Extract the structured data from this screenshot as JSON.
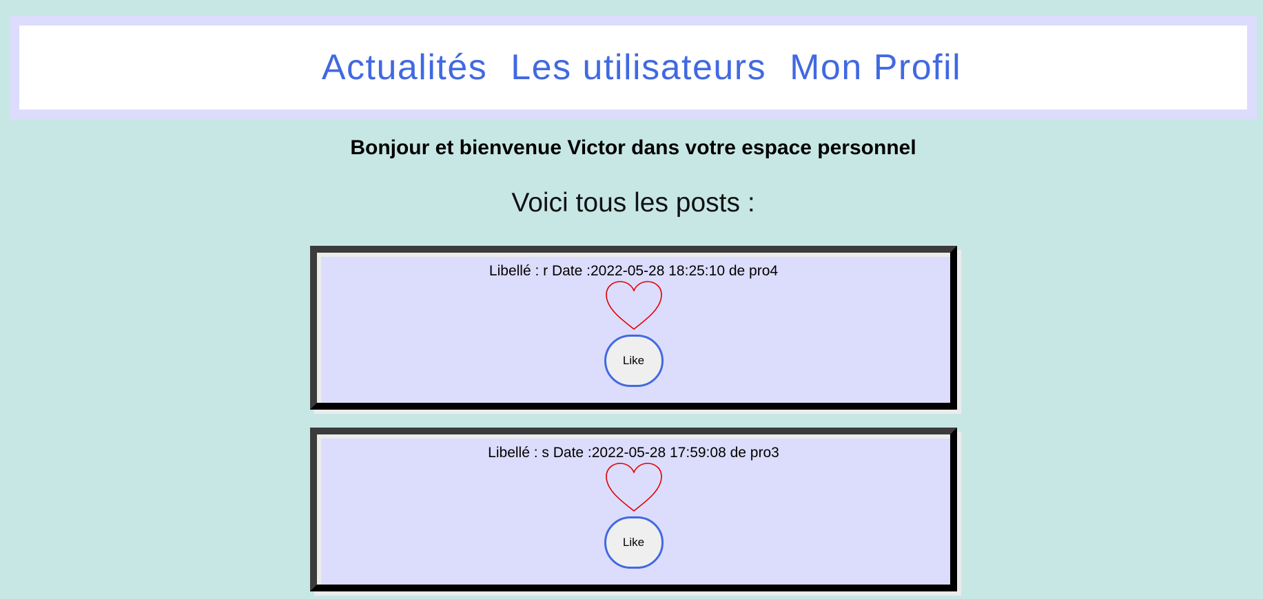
{
  "nav": {
    "links": [
      {
        "label": "Actualités"
      },
      {
        "label": "Les utilisateurs"
      },
      {
        "label": "Mon Profil"
      }
    ]
  },
  "welcome_text": "Bonjour et bienvenue Victor dans votre espace personnel",
  "posts_heading": "Voici tous les posts :",
  "posts": [
    {
      "meta": "Libellé : r Date :2022-05-28 18:25:10 de pro4",
      "like_label": "Like"
    },
    {
      "meta": "Libellé : s Date :2022-05-28 17:59:08 de pro3",
      "like_label": "Like"
    }
  ],
  "colors": {
    "page_bg": "#c7e7e5",
    "nav_link": "#4169e1",
    "card_bg": "#dcdcfc",
    "heart_stroke": "#e00000"
  },
  "icons": {
    "like_visual": "heart-outline"
  }
}
